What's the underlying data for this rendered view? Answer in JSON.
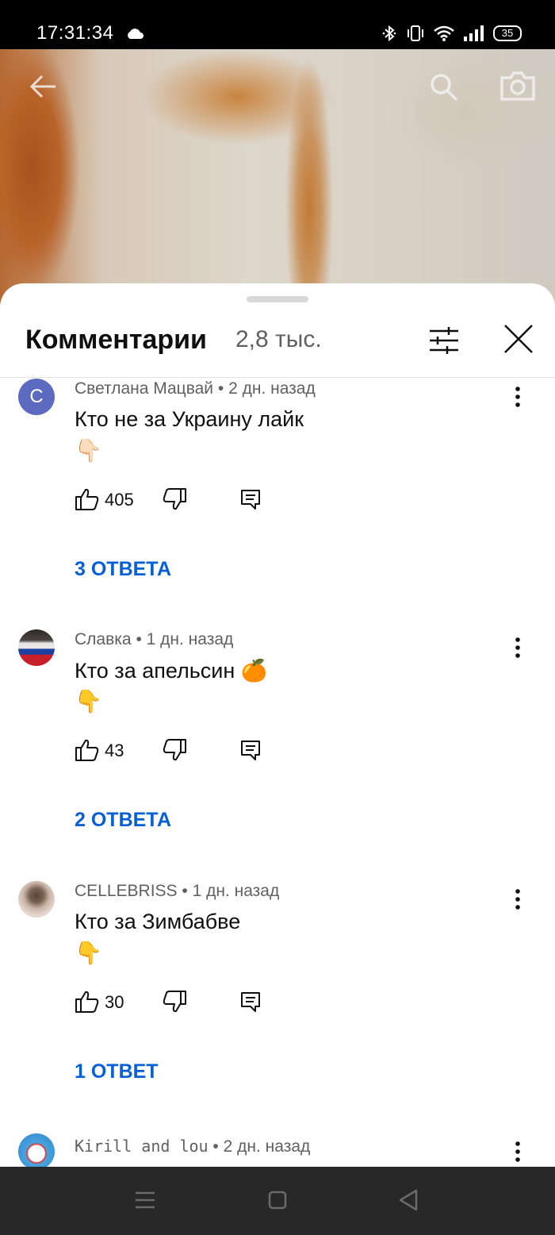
{
  "status_bar": {
    "time": "17:31:34",
    "battery": "35",
    "icons": [
      "cloud-icon",
      "bluetooth-icon",
      "vibrate-icon",
      "wifi-icon",
      "signal-icon",
      "battery-icon"
    ]
  },
  "video": {
    "icons": [
      "back-arrow-icon",
      "search-icon",
      "camera-icon"
    ]
  },
  "comments_panel": {
    "title": "Комментарии",
    "count": "2,8 тыс.",
    "icons": [
      "filter-icon",
      "close-icon"
    ]
  },
  "comments": [
    {
      "avatar_letter": "С",
      "author": "Светлана Мацвай",
      "time": "2 дн. назад",
      "text": "Кто не за Украину лайк",
      "emoji_line": "👇🏻",
      "likes": "405",
      "replies": "3 ОТВЕТА"
    },
    {
      "author": "Славка",
      "time": "1 дн. назад",
      "text": "Кто за апельсин 🍊",
      "emoji_line": "👇",
      "likes": "43",
      "replies": "2 ОТВЕТА"
    },
    {
      "author": "CELLEBRISS",
      "time": "1 дн. назад",
      "text": "Кто за Зимбабве",
      "emoji_line": "👇",
      "likes": "30",
      "replies": "1 ОТВЕТ"
    },
    {
      "author": "Kirill and lou",
      "time": "2 дн. назад"
    }
  ],
  "meta_separator": "•",
  "colors": {
    "link_blue": "#065fd4",
    "secondary_text": "#606060",
    "avatar_purple": "#5c6bc0",
    "nav_bar": "#282828"
  }
}
